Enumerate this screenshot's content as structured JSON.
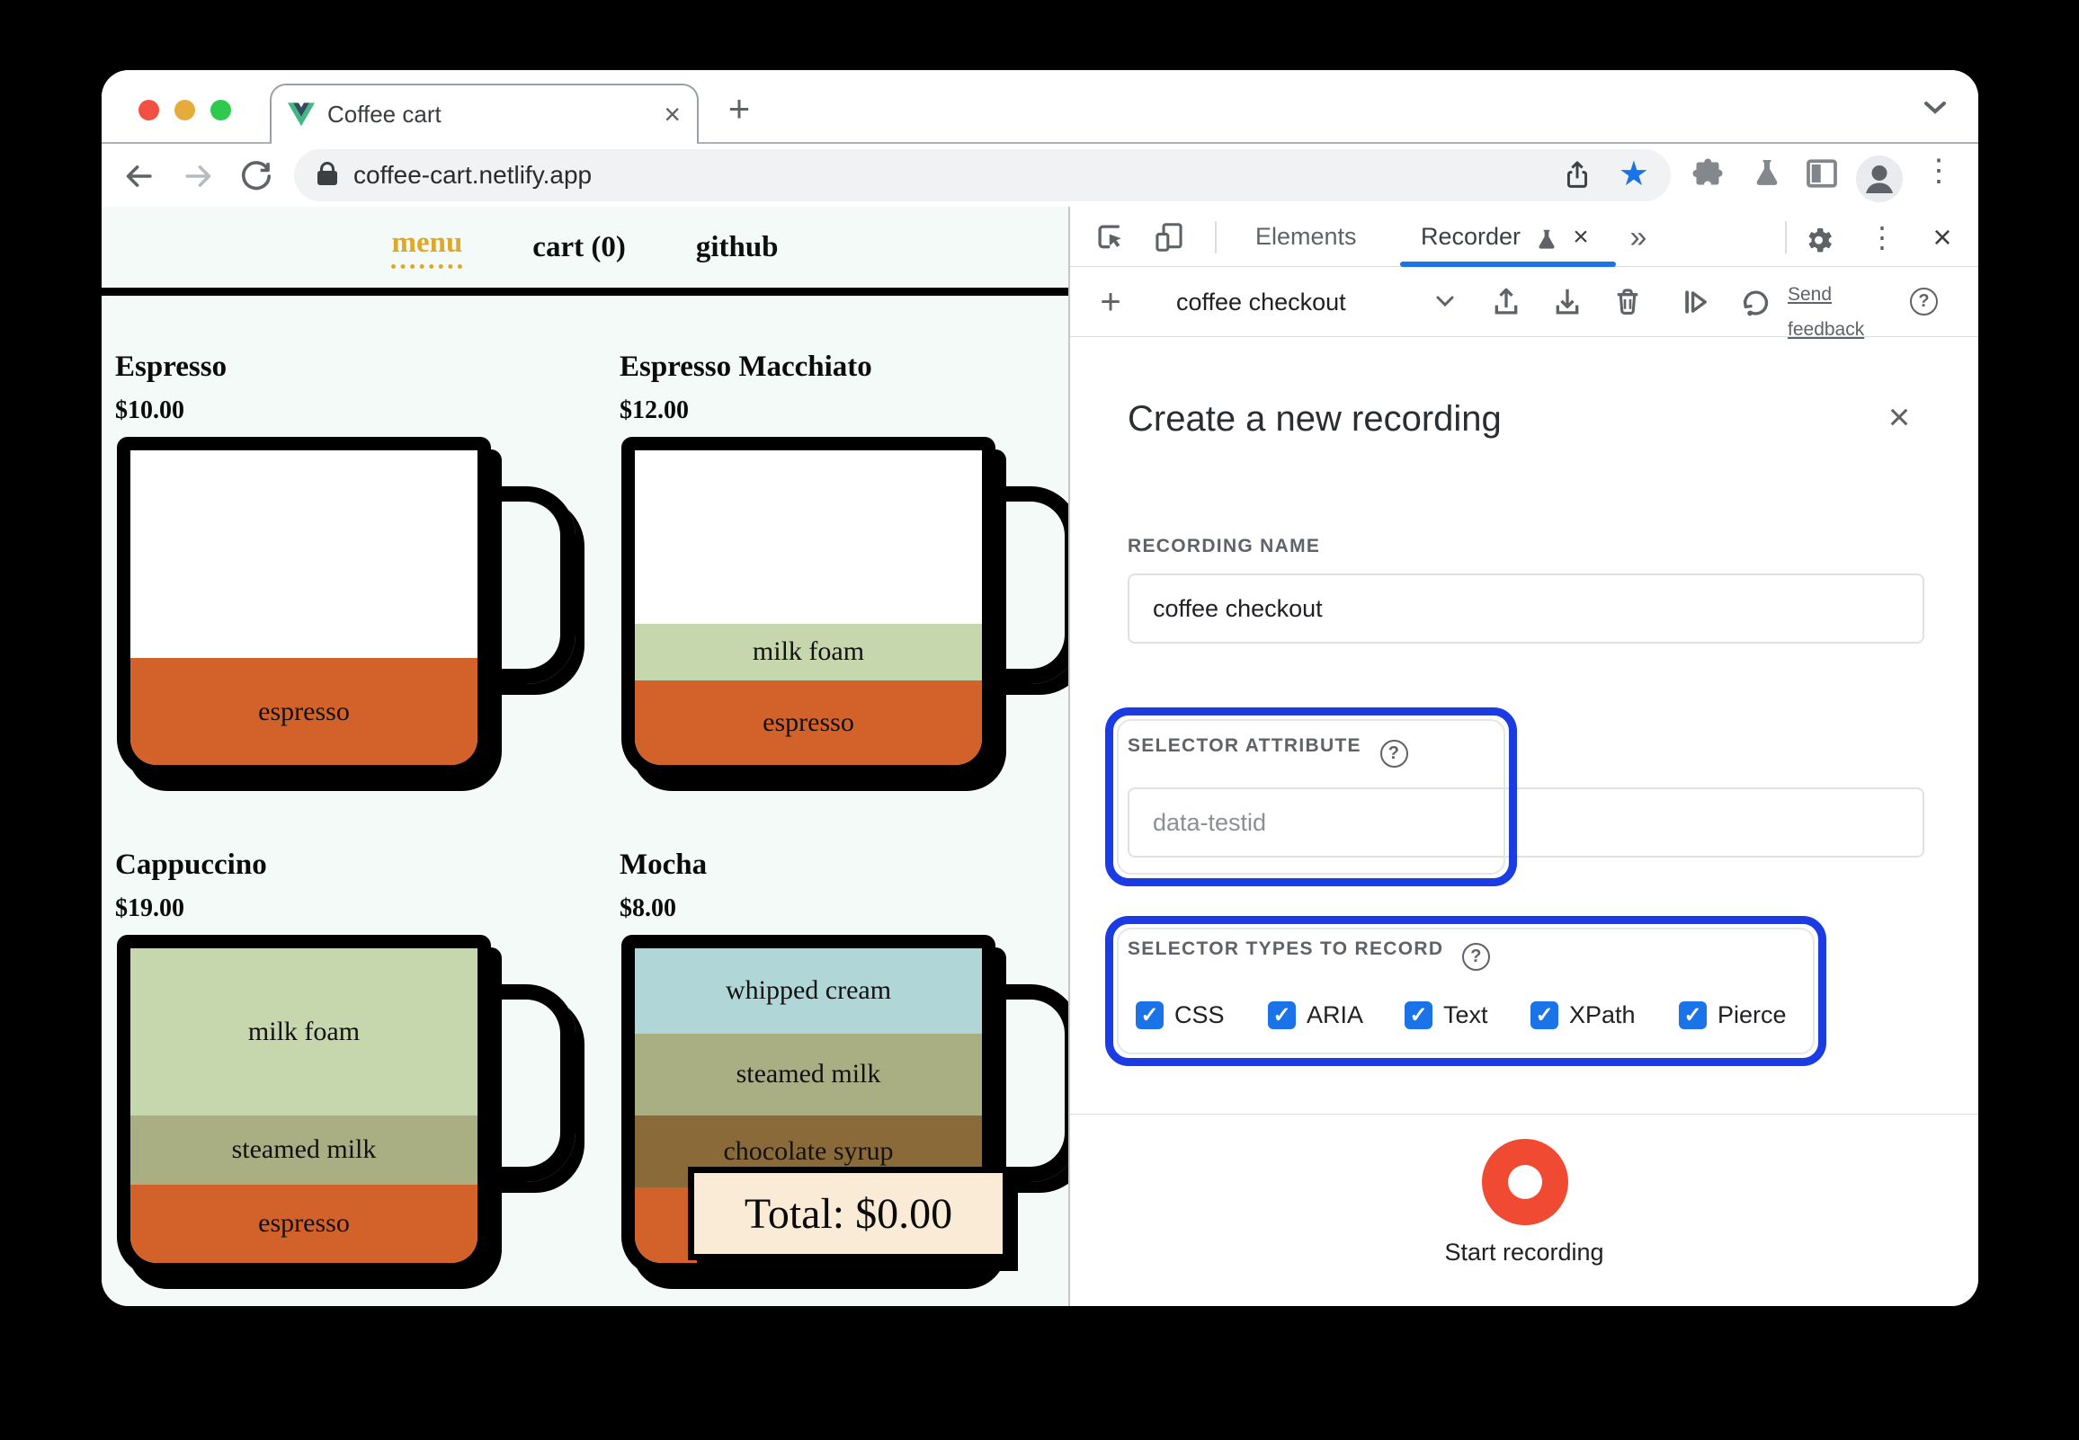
{
  "icons": {
    "close": "×",
    "check": "✓",
    "star": "★",
    "dots": "⋮",
    "more_tabs": "»",
    "plus": "+",
    "question": "?"
  },
  "browser": {
    "tab_title": "Coffee cart",
    "url": "coffee-cart.netlify.app"
  },
  "page": {
    "nav": [
      {
        "label": "menu",
        "active": true
      },
      {
        "label": "cart (0)",
        "active": false
      },
      {
        "label": "github",
        "active": false
      }
    ],
    "products": [
      {
        "name": "Espresso",
        "price": "$10.00",
        "layers": [
          {
            "label": "espresso",
            "color": "#d2612a",
            "pct": 34
          }
        ]
      },
      {
        "name": "Espresso Macchiato",
        "price": "$12.00",
        "layers": [
          {
            "label": "milk foam",
            "color": "#c6d7ad",
            "pct": 18
          },
          {
            "label": "espresso",
            "color": "#d2612a",
            "pct": 27
          }
        ]
      },
      {
        "name": "Cappuccino",
        "price": "$19.00",
        "layers": [
          {
            "label": "milk foam",
            "color": "#c6d7ad",
            "pct": 53
          },
          {
            "label": "steamed milk",
            "color": "#a9ae83",
            "pct": 22
          },
          {
            "label": "espresso",
            "color": "#d2612a",
            "pct": 25
          }
        ]
      },
      {
        "name": "Mocha",
        "price": "$8.00",
        "layers": [
          {
            "label": "whipped cream",
            "color": "#b0d6d8",
            "pct": 27
          },
          {
            "label": "steamed milk",
            "color": "#a9ae83",
            "pct": 26
          },
          {
            "label": "chocolate syrup",
            "color": "#8a6a39",
            "pct": 23
          },
          {
            "label": "",
            "color": "#d2612a",
            "pct": 24
          }
        ]
      }
    ],
    "total": "Total: $0.00"
  },
  "devtools": {
    "tabs": [
      {
        "label": "Elements",
        "active": false
      },
      {
        "label": "Recorder",
        "active": true
      }
    ],
    "toolbar": {
      "recording_select": "coffee checkout",
      "send_feedback": "Send feedback"
    },
    "dialog": {
      "title": "Create a new recording",
      "recording_name_label": "RECORDING NAME",
      "recording_name_value": "coffee checkout",
      "selector_attribute_label": "SELECTOR ATTRIBUTE",
      "selector_attribute_placeholder": "data-testid",
      "selector_types_label": "SELECTOR TYPES TO RECORD",
      "selector_types": [
        {
          "label": "CSS",
          "checked": true
        },
        {
          "label": "ARIA",
          "checked": true
        },
        {
          "label": "Text",
          "checked": true
        },
        {
          "label": "XPath",
          "checked": true
        },
        {
          "label": "Pierce",
          "checked": true
        }
      ],
      "start_recording": "Start recording"
    },
    "colors": {
      "annotation_blue": "#1b3ce4",
      "accent_blue": "#1a73e8",
      "record_red": "#f04a33"
    }
  }
}
